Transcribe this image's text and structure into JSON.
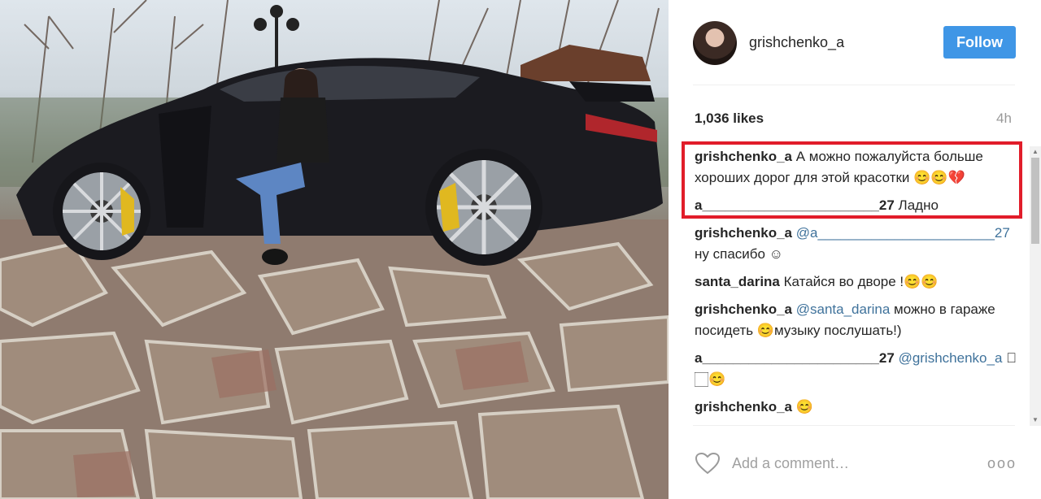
{
  "post": {
    "photo_alt_icon": "car-photo",
    "username": "grishchenko_a",
    "follow_label": "Follow",
    "likes": "1,036 likes",
    "time_ago": "4h"
  },
  "comments": [
    {
      "author": "grishchenko_a",
      "parts": [
        {
          "text": " А можно пожалуйста больше хороших дорог для этой красотки 😊😊💔",
          "mention": false
        }
      ]
    },
    {
      "author": "a_______________________27",
      "parts": [
        {
          "text": " Ладно",
          "mention": false
        }
      ]
    },
    {
      "author": "grishchenko_a",
      "parts": [
        {
          "text": " ",
          "mention": false
        },
        {
          "text": "@a_______________________27",
          "mention": true
        },
        {
          "text": " ну спасибо ☺",
          "mention": false
        }
      ]
    },
    {
      "author": "santa_darina",
      "parts": [
        {
          "text": " Катайся во дворе !😊😊",
          "mention": false
        }
      ]
    },
    {
      "author": "grishchenko_a",
      "parts": [
        {
          "text": " ",
          "mention": false
        },
        {
          "text": "@santa_darina",
          "mention": true
        },
        {
          "text": " можно в гараже посидеть 😊музыку послушать!)",
          "mention": false
        }
      ]
    },
    {
      "author": "a_______________________27",
      "parts": [
        {
          "text": " ",
          "mention": false
        },
        {
          "text": "@grishchenko_a",
          "mention": true
        },
        {
          "text": " 🏻🏻😊",
          "mention": false
        }
      ]
    },
    {
      "author": "grishchenko_a",
      "parts": [
        {
          "text": " 😊",
          "mention": false
        }
      ]
    }
  ],
  "footer": {
    "comment_placeholder": "Add a comment…",
    "more_label": "ooo"
  },
  "colors": {
    "accent": "#3f96e6",
    "highlight": "#e11d2a",
    "mention": "#3f729b"
  }
}
